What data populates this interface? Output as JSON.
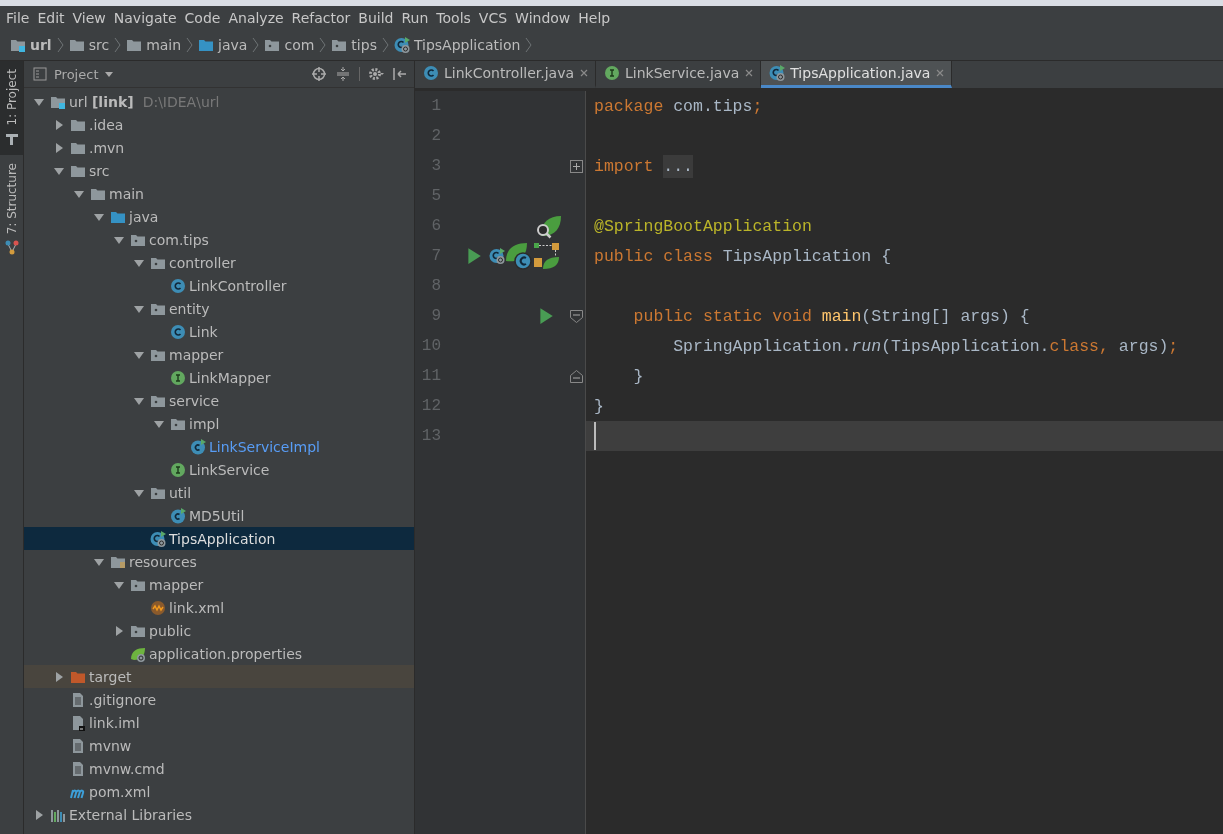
{
  "menu": [
    "File",
    "Edit",
    "View",
    "Navigate",
    "Code",
    "Analyze",
    "Refactor",
    "Build",
    "Run",
    "Tools",
    "VCS",
    "Window",
    "Help"
  ],
  "breadcrumbs": [
    {
      "label": "url",
      "kind": "module"
    },
    {
      "label": "src",
      "kind": "folder"
    },
    {
      "label": "main",
      "kind": "folder"
    },
    {
      "label": "java",
      "kind": "source"
    },
    {
      "label": "com",
      "kind": "package"
    },
    {
      "label": "tips",
      "kind": "package"
    },
    {
      "label": "TipsApplication",
      "kind": "spring-class"
    }
  ],
  "tool_windows": [
    {
      "label": "1: Project",
      "kind": "project",
      "selected": true
    },
    {
      "label": "7: Structure",
      "kind": "structure",
      "selected": false
    }
  ],
  "project": {
    "title": "Project",
    "tree": [
      {
        "label": "url **[link]**",
        "path": "D:\\IDEA\\url",
        "kind": "module",
        "expanded": true,
        "selected": false,
        "children": [
          {
            "label": ".idea",
            "kind": "folder",
            "expanded": false,
            "selected": false
          },
          {
            "label": ".mvn",
            "kind": "folder",
            "expanded": false,
            "selected": false
          },
          {
            "label": "src",
            "kind": "folder",
            "expanded": true,
            "selected": false,
            "children": [
              {
                "label": "main",
                "kind": "folder",
                "expanded": true,
                "selected": false,
                "children": [
                  {
                    "label": "java",
                    "kind": "source",
                    "expanded": true,
                    "selected": false,
                    "children": [
                      {
                        "label": "com.tips",
                        "kind": "package",
                        "expanded": true,
                        "selected": false,
                        "children": [
                          {
                            "label": "controller",
                            "kind": "package",
                            "expanded": true,
                            "selected": false,
                            "children": [
                              {
                                "label": "LinkController",
                                "kind": "class",
                                "selected": false
                              }
                            ]
                          },
                          {
                            "label": "entity",
                            "kind": "package",
                            "expanded": true,
                            "selected": false,
                            "children": [
                              {
                                "label": "Link",
                                "kind": "class",
                                "selected": false
                              }
                            ]
                          },
                          {
                            "label": "mapper",
                            "kind": "package",
                            "expanded": true,
                            "selected": false,
                            "children": [
                              {
                                "label": "LinkMapper",
                                "kind": "interface",
                                "selected": false
                              }
                            ]
                          },
                          {
                            "label": "service",
                            "kind": "package",
                            "expanded": true,
                            "selected": false,
                            "children": [
                              {
                                "label": "impl",
                                "kind": "package",
                                "expanded": true,
                                "selected": false,
                                "children": [
                                  {
                                    "label": "LinkServiceImpl",
                                    "kind": "run-class",
                                    "selected": false,
                                    "color": "#589df6"
                                  }
                                ]
                              },
                              {
                                "label": "LinkService",
                                "kind": "interface",
                                "selected": false
                              }
                            ]
                          },
                          {
                            "label": "util",
                            "kind": "package",
                            "expanded": true,
                            "selected": false,
                            "children": [
                              {
                                "label": "MD5Util",
                                "kind": "run-class",
                                "selected": false
                              }
                            ]
                          },
                          {
                            "label": "TipsApplication",
                            "kind": "spring-class",
                            "selected": true
                          }
                        ]
                      }
                    ]
                  },
                  {
                    "label": "resources",
                    "kind": "resources",
                    "expanded": true,
                    "selected": false,
                    "children": [
                      {
                        "label": "mapper",
                        "kind": "package",
                        "expanded": true,
                        "selected": false,
                        "children": [
                          {
                            "label": "link.xml",
                            "kind": "xml",
                            "selected": false
                          }
                        ]
                      },
                      {
                        "label": "public",
                        "kind": "package",
                        "expanded": false,
                        "selected": false
                      },
                      {
                        "label": "application.properties",
                        "kind": "properties",
                        "selected": false
                      }
                    ]
                  }
                ]
              }
            ]
          },
          {
            "label": "target",
            "kind": "excluded",
            "expanded": false,
            "selected": false
          },
          {
            "label": ".gitignore",
            "kind": "text",
            "selected": false
          },
          {
            "label": "link.iml",
            "kind": "iml",
            "selected": false
          },
          {
            "label": "mvnw",
            "kind": "text",
            "selected": false
          },
          {
            "label": "mvnw.cmd",
            "kind": "text",
            "selected": false
          },
          {
            "label": "pom.xml",
            "kind": "maven",
            "selected": false
          }
        ]
      },
      {
        "label": "External Libraries",
        "kind": "libraries",
        "expanded": false,
        "selected": false
      }
    ]
  },
  "editor": {
    "tabs": [
      {
        "label": "LinkController.java",
        "kind": "class",
        "selected": false
      },
      {
        "label": "LinkService.java",
        "kind": "interface",
        "selected": false
      },
      {
        "label": "TipsApplication.java",
        "kind": "spring-class",
        "selected": true
      }
    ],
    "lines": [
      {
        "number": "1",
        "tokens": [
          {
            "text": "package",
            "kind": "keyword"
          },
          {
            "text": " com.tips",
            "kind": "plain"
          },
          {
            "text": ";",
            "kind": "keyword"
          }
        ]
      },
      {
        "number": "2"
      },
      {
        "number": "3",
        "fold": {
          "kind": "collapsed"
        },
        "tokens": [
          {
            "text": "import ",
            "kind": "keyword"
          },
          {
            "text": "...",
            "kind": "folded"
          }
        ]
      },
      {
        "number": "5"
      },
      {
        "number": "6",
        "gutter": [
          {
            "kind": "spring-search"
          }
        ],
        "tokens": [
          {
            "text": "@SpringBootApplication",
            "kind": "annotation"
          }
        ]
      },
      {
        "number": "7",
        "gutter": [
          {
            "kind": "run"
          },
          {
            "kind": "spring-class"
          },
          {
            "kind": "bean"
          },
          {
            "kind": "bean-graph"
          }
        ],
        "tokens": [
          {
            "text": "public class",
            "kind": "keyword"
          },
          {
            "text": " TipsApplication {",
            "kind": "plain"
          }
        ]
      },
      {
        "number": "8"
      },
      {
        "number": "9",
        "gutter": [
          {
            "kind": "run"
          }
        ],
        "fold": {
          "kind": "start"
        },
        "tokens": [
          {
            "text": "    public static void ",
            "kind": "keyword"
          },
          {
            "text": "main",
            "kind": "method"
          },
          {
            "text": "(String[] args) {",
            "kind": "plain"
          }
        ]
      },
      {
        "number": "10",
        "tokens": [
          {
            "text": "        SpringApplication.",
            "kind": "plain"
          },
          {
            "text": "run",
            "kind": "static"
          },
          {
            "text": "(TipsApplication.",
            "kind": "plain"
          },
          {
            "text": "class,",
            "kind": "keyword"
          },
          {
            "text": " args)",
            "kind": "plain"
          },
          {
            "text": ";",
            "kind": "keyword"
          }
        ]
      },
      {
        "number": "11",
        "fold": {
          "kind": "end"
        },
        "tokens": [
          {
            "text": "    }",
            "kind": "plain"
          }
        ]
      },
      {
        "number": "12",
        "tokens": [
          {
            "text": "}",
            "kind": "plain"
          }
        ]
      },
      {
        "number": "13",
        "current": true
      }
    ]
  }
}
